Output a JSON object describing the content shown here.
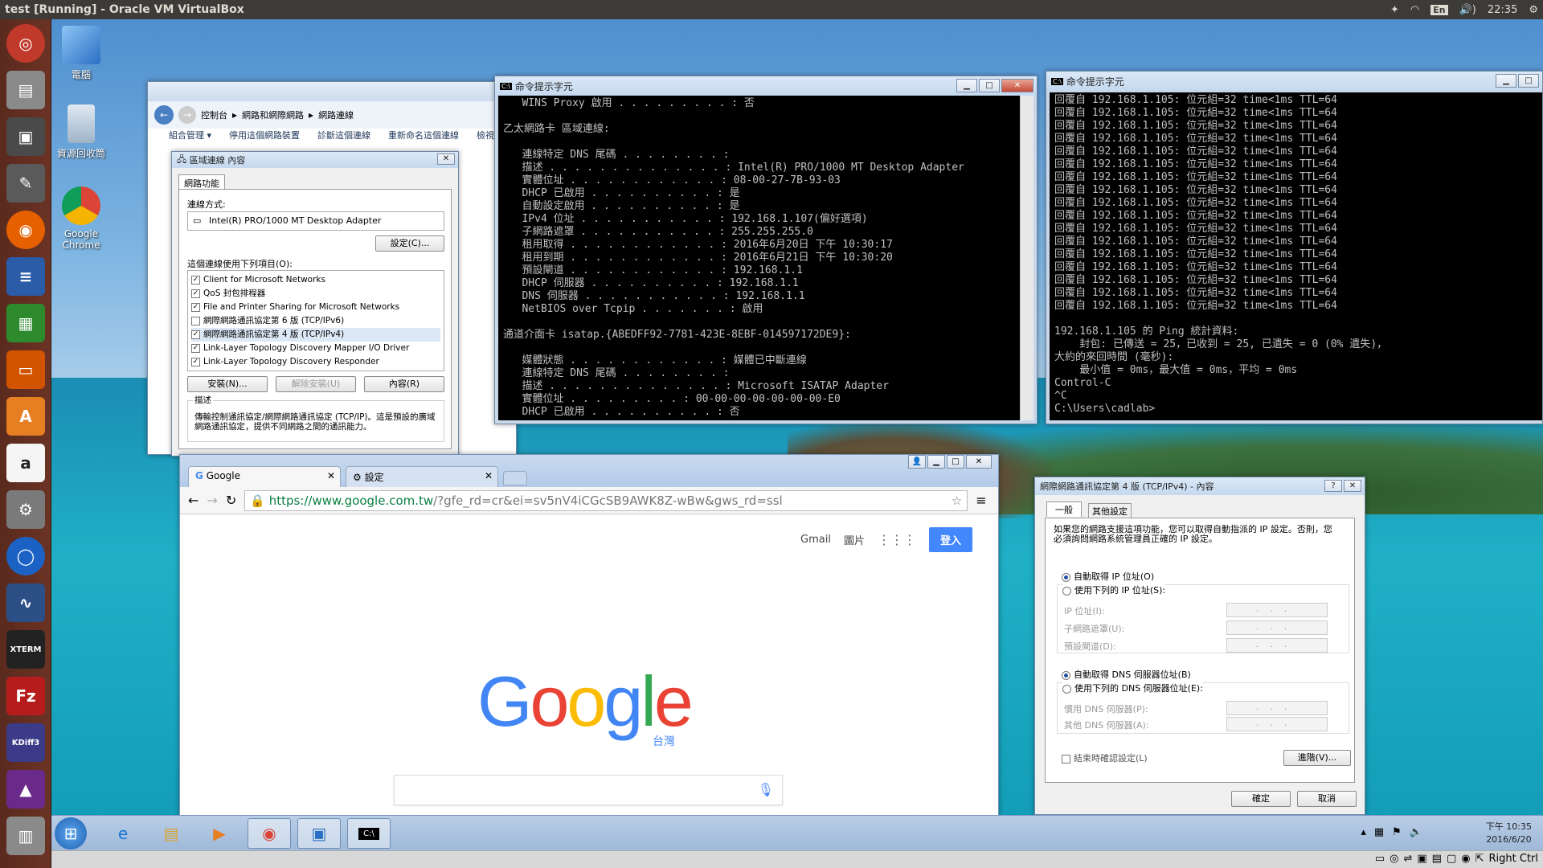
{
  "topbar": {
    "title": "test [Running] - Oracle VM VirtualBox",
    "lang": "En",
    "volume": "🔊)",
    "time": "22:35"
  },
  "desktop": {
    "icons": [
      {
        "label": "電腦"
      },
      {
        "label": "資源回收筒"
      },
      {
        "label": "Google Chrome"
      }
    ]
  },
  "explorer": {
    "breadcrumb": [
      "控制台",
      "網路和網際網路",
      "網路連線"
    ],
    "toolbar": [
      "組合管理 ▾",
      "停用這個網路裝置",
      "診斷這個連線",
      "重新命名這個連線",
      "檢視這個連"
    ]
  },
  "lan_props": {
    "title": "區域連線 內容",
    "tab": "網路功能",
    "connect_using_label": "連線方式:",
    "adapter": "Intel(R) PRO/1000 MT Desktop Adapter",
    "configure": "設定(C)...",
    "items_label": "這個連線使用下列項目(O):",
    "items": [
      {
        "label": "Client for Microsoft Networks",
        "checked": "✓"
      },
      {
        "label": "QoS 封包排程器",
        "checked": "✓"
      },
      {
        "label": "File and Printer Sharing for Microsoft Networks",
        "checked": "✓"
      },
      {
        "label": "網際網路通訊協定第 6 版 (TCP/IPv6)",
        "checked": ""
      },
      {
        "label": "網際網路通訊協定第 4 版 (TCP/IPv4)",
        "checked": "✓"
      },
      {
        "label": "Link-Layer Topology Discovery Mapper I/O Driver",
        "checked": "✓"
      },
      {
        "label": "Link-Layer Topology Discovery Responder",
        "checked": "✓"
      }
    ],
    "install": "安裝(N)...",
    "uninstall": "解除安裝(U)",
    "properties": "內容(R)",
    "desc_label": "描述",
    "desc": "傳輸控制通訊協定/網際網路通訊協定 (TCP/IP)。這是預設的廣域網路通訊協定，提供不同網路之間的通訊能力。"
  },
  "cmd1": {
    "title": "命令提示字元",
    "lines": [
      "   WINS Proxy 啟用 . . . . . . . . . : 否",
      "",
      "乙太網路卡 區域連線:",
      "",
      "   連線特定 DNS 尾碼 . . . . . . . . :",
      "   描述 . . . . . . . . . . . . . . : Intel(R) PRO/1000 MT Desktop Adapter",
      "   實體位址 . . . . . . . . . . . . : 08-00-27-7B-93-03",
      "   DHCP 已啟用 . . . . . . . . . . : 是",
      "   自動設定啟用 . . . . . . . . . . : 是",
      "   IPv4 位址 . . . . . . . . . . . : 192.168.1.107(偏好選項)",
      "   子網路遮罩 . . . . . . . . . . . : 255.255.255.0",
      "   租用取得 . . . . . . . . . . . . : 2016年6月20日 下午 10:30:17",
      "   租用到期 . . . . . . . . . . . . : 2016年6月21日 下午 10:30:20",
      "   預設閘道 . . . . . . . . . . . . : 192.168.1.1",
      "   DHCP 伺服器 . . . . . . . . . . : 192.168.1.1",
      "   DNS 伺服器 . . . . . . . . . . . : 192.168.1.1",
      "   NetBIOS over Tcpip . . . . . . . : 啟用",
      "",
      "通道介面卡 isatap.{ABEDFF92-7781-423E-8EBF-014597172DE9}:",
      "",
      "   媒體狀態 . . . . . . . . . . . . : 媒體已中斷連線",
      "   連線特定 DNS 尾碼 . . . . . . . . :",
      "   描述 . . . . . . . . . . . . . . : Microsoft ISATAP Adapter",
      "   實體位址 . . . . . . . . . : 00-00-00-00-00-00-00-E0",
      "   DHCP 已啟用 . . . . . . . . . . : 否"
    ]
  },
  "cmd2": {
    "title": "命令提示字元",
    "lines": [
      "回覆自 192.168.1.105: 位元組=32 time<1ms TTL=64",
      "回覆自 192.168.1.105: 位元組=32 time<1ms TTL=64",
      "回覆自 192.168.1.105: 位元組=32 time<1ms TTL=64",
      "回覆自 192.168.1.105: 位元組=32 time<1ms TTL=64",
      "回覆自 192.168.1.105: 位元組=32 time<1ms TTL=64",
      "回覆自 192.168.1.105: 位元組=32 time<1ms TTL=64",
      "回覆自 192.168.1.105: 位元組=32 time<1ms TTL=64",
      "回覆自 192.168.1.105: 位元組=32 time<1ms TTL=64",
      "回覆自 192.168.1.105: 位元組=32 time<1ms TTL=64",
      "回覆自 192.168.1.105: 位元組=32 time<1ms TTL=64",
      "回覆自 192.168.1.105: 位元組=32 time<1ms TTL=64",
      "回覆自 192.168.1.105: 位元組=32 time<1ms TTL=64",
      "回覆自 192.168.1.105: 位元組=32 time<1ms TTL=64",
      "回覆自 192.168.1.105: 位元組=32 time<1ms TTL=64",
      "回覆自 192.168.1.105: 位元組=32 time<1ms TTL=64",
      "回覆自 192.168.1.105: 位元組=32 time<1ms TTL=64",
      "回覆自 192.168.1.105: 位元組=32 time<1ms TTL=64",
      "",
      "192.168.1.105 的 Ping 統計資料:",
      "    封包: 已傳送 = 25，已收到 = 25, 已遺失 = 0 (0% 遺失)，",
      "大約的來回時間 (毫秒):",
      "    最小值 = 0ms，最大值 = 0ms，平均 = 0ms",
      "Control-C",
      "^C",
      "C:\\Users\\cadlab>"
    ]
  },
  "chrome": {
    "tabs": [
      {
        "label": "Google"
      },
      {
        "label": "設定"
      }
    ],
    "url_host": "https://www.google.com.tw",
    "url_rest": "/?gfe_rd=cr&ei=sv5nV4iCGcSB9AWK8Z-wBw&gws_rd=ssl",
    "gmail": "Gmail",
    "images": "圖片",
    "signin": "登入",
    "logo_region": "台灣"
  },
  "ipv4": {
    "title": "網際網路通訊協定第 4 版 (TCP/IPv4) - 內容",
    "tab_general": "一般",
    "tab_alt": "其他設定",
    "intro": "如果您的網路支援這項功能，您可以取得自動指派的 IP 設定。否則，您必須詢問網路系統管理員正確的 IP 設定。",
    "auto_ip": "自動取得 IP 位址(O)",
    "manual_ip": "使用下列的 IP 位址(S):",
    "ip": "IP 位址(I):",
    "mask": "子網路遮罩(U):",
    "gw": "預設閘道(D):",
    "auto_dns": "自動取得 DNS 伺服器位址(B)",
    "manual_dns": "使用下列的 DNS 伺服器位址(E):",
    "pdns": "慣用 DNS 伺服器(P):",
    "adns": "其他 DNS 伺服器(A):",
    "validate": "結束時確認設定(L)",
    "advanced": "進階(V)...",
    "ok": "確定",
    "cancel": "取消"
  },
  "taskbar": {
    "clock_time": "下午 10:35",
    "clock_date": "2016/6/20"
  },
  "vbox": {
    "hostkey": "Right Ctrl"
  }
}
